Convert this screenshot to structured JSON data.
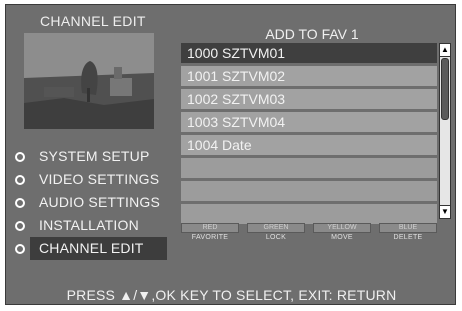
{
  "screen": {
    "title": "CHANNEL EDIT",
    "panel_title": "ADD TO FAV 1",
    "footer_hint": "PRESS ▲/▼,OK KEY TO SELECT, EXIT: RETURN"
  },
  "menu": {
    "items": [
      {
        "label": "SYSTEM SETUP"
      },
      {
        "label": "VIDEO SETTINGS"
      },
      {
        "label": "AUDIO SETTINGS"
      },
      {
        "label": "INSTALLATION"
      },
      {
        "label": "CHANNEL EDIT",
        "active": true
      }
    ]
  },
  "channels": [
    {
      "label": "1000 SZTVM01",
      "selected": true
    },
    {
      "label": "1001 SZTVM02"
    },
    {
      "label": "1002 SZTVM03"
    },
    {
      "label": "1003 SZTVM04"
    },
    {
      "label": "1004 Date"
    },
    {
      "label": ""
    },
    {
      "label": ""
    },
    {
      "label": ""
    }
  ],
  "color_keys": [
    {
      "color": "RED",
      "action": "FAVORITE"
    },
    {
      "color": "GREEN",
      "action": "LOCK"
    },
    {
      "color": "YELLOW",
      "action": "MOVE"
    },
    {
      "color": "BLUE",
      "action": "DELETE"
    }
  ],
  "scrollbar": {
    "up_glyph": "▲",
    "down_glyph": "▼"
  },
  "colors": {
    "panel_bg": "#6e6e6e",
    "row_bg": "#a2a2a2",
    "row_selected": "#3f3f3f"
  }
}
